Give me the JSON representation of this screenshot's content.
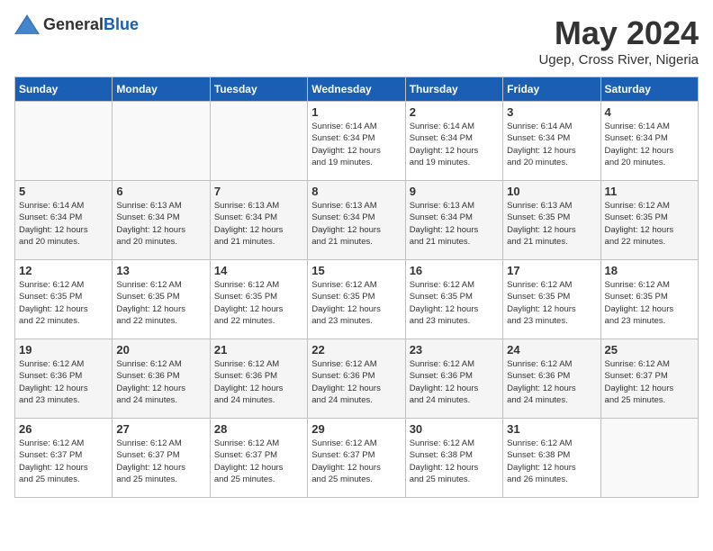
{
  "header": {
    "logo_general": "General",
    "logo_blue": "Blue",
    "month_year": "May 2024",
    "location": "Ugep, Cross River, Nigeria"
  },
  "days_of_week": [
    "Sunday",
    "Monday",
    "Tuesday",
    "Wednesday",
    "Thursday",
    "Friday",
    "Saturday"
  ],
  "weeks": [
    [
      {
        "day": "",
        "info": ""
      },
      {
        "day": "",
        "info": ""
      },
      {
        "day": "",
        "info": ""
      },
      {
        "day": "1",
        "info": "Sunrise: 6:14 AM\nSunset: 6:34 PM\nDaylight: 12 hours\nand 19 minutes."
      },
      {
        "day": "2",
        "info": "Sunrise: 6:14 AM\nSunset: 6:34 PM\nDaylight: 12 hours\nand 19 minutes."
      },
      {
        "day": "3",
        "info": "Sunrise: 6:14 AM\nSunset: 6:34 PM\nDaylight: 12 hours\nand 20 minutes."
      },
      {
        "day": "4",
        "info": "Sunrise: 6:14 AM\nSunset: 6:34 PM\nDaylight: 12 hours\nand 20 minutes."
      }
    ],
    [
      {
        "day": "5",
        "info": "Sunrise: 6:14 AM\nSunset: 6:34 PM\nDaylight: 12 hours\nand 20 minutes."
      },
      {
        "day": "6",
        "info": "Sunrise: 6:13 AM\nSunset: 6:34 PM\nDaylight: 12 hours\nand 20 minutes."
      },
      {
        "day": "7",
        "info": "Sunrise: 6:13 AM\nSunset: 6:34 PM\nDaylight: 12 hours\nand 21 minutes."
      },
      {
        "day": "8",
        "info": "Sunrise: 6:13 AM\nSunset: 6:34 PM\nDaylight: 12 hours\nand 21 minutes."
      },
      {
        "day": "9",
        "info": "Sunrise: 6:13 AM\nSunset: 6:34 PM\nDaylight: 12 hours\nand 21 minutes."
      },
      {
        "day": "10",
        "info": "Sunrise: 6:13 AM\nSunset: 6:35 PM\nDaylight: 12 hours\nand 21 minutes."
      },
      {
        "day": "11",
        "info": "Sunrise: 6:12 AM\nSunset: 6:35 PM\nDaylight: 12 hours\nand 22 minutes."
      }
    ],
    [
      {
        "day": "12",
        "info": "Sunrise: 6:12 AM\nSunset: 6:35 PM\nDaylight: 12 hours\nand 22 minutes."
      },
      {
        "day": "13",
        "info": "Sunrise: 6:12 AM\nSunset: 6:35 PM\nDaylight: 12 hours\nand 22 minutes."
      },
      {
        "day": "14",
        "info": "Sunrise: 6:12 AM\nSunset: 6:35 PM\nDaylight: 12 hours\nand 22 minutes."
      },
      {
        "day": "15",
        "info": "Sunrise: 6:12 AM\nSunset: 6:35 PM\nDaylight: 12 hours\nand 23 minutes."
      },
      {
        "day": "16",
        "info": "Sunrise: 6:12 AM\nSunset: 6:35 PM\nDaylight: 12 hours\nand 23 minutes."
      },
      {
        "day": "17",
        "info": "Sunrise: 6:12 AM\nSunset: 6:35 PM\nDaylight: 12 hours\nand 23 minutes."
      },
      {
        "day": "18",
        "info": "Sunrise: 6:12 AM\nSunset: 6:35 PM\nDaylight: 12 hours\nand 23 minutes."
      }
    ],
    [
      {
        "day": "19",
        "info": "Sunrise: 6:12 AM\nSunset: 6:36 PM\nDaylight: 12 hours\nand 23 minutes."
      },
      {
        "day": "20",
        "info": "Sunrise: 6:12 AM\nSunset: 6:36 PM\nDaylight: 12 hours\nand 24 minutes."
      },
      {
        "day": "21",
        "info": "Sunrise: 6:12 AM\nSunset: 6:36 PM\nDaylight: 12 hours\nand 24 minutes."
      },
      {
        "day": "22",
        "info": "Sunrise: 6:12 AM\nSunset: 6:36 PM\nDaylight: 12 hours\nand 24 minutes."
      },
      {
        "day": "23",
        "info": "Sunrise: 6:12 AM\nSunset: 6:36 PM\nDaylight: 12 hours\nand 24 minutes."
      },
      {
        "day": "24",
        "info": "Sunrise: 6:12 AM\nSunset: 6:36 PM\nDaylight: 12 hours\nand 24 minutes."
      },
      {
        "day": "25",
        "info": "Sunrise: 6:12 AM\nSunset: 6:37 PM\nDaylight: 12 hours\nand 25 minutes."
      }
    ],
    [
      {
        "day": "26",
        "info": "Sunrise: 6:12 AM\nSunset: 6:37 PM\nDaylight: 12 hours\nand 25 minutes."
      },
      {
        "day": "27",
        "info": "Sunrise: 6:12 AM\nSunset: 6:37 PM\nDaylight: 12 hours\nand 25 minutes."
      },
      {
        "day": "28",
        "info": "Sunrise: 6:12 AM\nSunset: 6:37 PM\nDaylight: 12 hours\nand 25 minutes."
      },
      {
        "day": "29",
        "info": "Sunrise: 6:12 AM\nSunset: 6:37 PM\nDaylight: 12 hours\nand 25 minutes."
      },
      {
        "day": "30",
        "info": "Sunrise: 6:12 AM\nSunset: 6:38 PM\nDaylight: 12 hours\nand 25 minutes."
      },
      {
        "day": "31",
        "info": "Sunrise: 6:12 AM\nSunset: 6:38 PM\nDaylight: 12 hours\nand 26 minutes."
      },
      {
        "day": "",
        "info": ""
      }
    ]
  ]
}
